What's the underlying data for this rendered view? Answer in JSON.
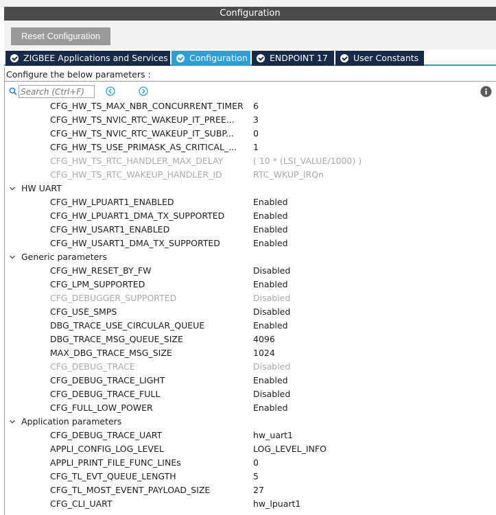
{
  "window": {
    "title": "Configuration"
  },
  "toolbar": {
    "reset_label": "Reset Configuration"
  },
  "tabs": [
    {
      "label": "ZIGBEE Applications and Services",
      "active": false
    },
    {
      "label": "Configuration",
      "active": true
    },
    {
      "label": "ENDPOINT 17",
      "active": false
    },
    {
      "label": "User Constants",
      "active": false
    }
  ],
  "panel": {
    "header": "Configure the below parameters :"
  },
  "search": {
    "placeholder": "Search (Ctrl+F)"
  },
  "icons": {
    "search": "search-icon",
    "prev": "arrow-left-circle-icon",
    "next": "arrow-right-circle-icon",
    "info": "info-icon",
    "expand": "chevron-down-icon",
    "tab_status": "check-circle-icon"
  },
  "colors": {
    "title_bar": "#4b4b4b",
    "tab_bg": "#172a4a",
    "tab_active": "#2aa0d8",
    "disabled_text": "#a9a9a9",
    "reset_button": "#9a9a9a"
  },
  "params": {
    "ts_rows": [
      {
        "name": "CFG_HW_TS_MAX_NBR_CONCURRENT_TIMER",
        "value": "6",
        "disabled": false
      },
      {
        "name": "CFG_HW_TS_NVIC_RTC_WAKEUP_IT_PREE...",
        "value": "3",
        "disabled": false
      },
      {
        "name": "CFG_HW_TS_NVIC_RTC_WAKEUP_IT_SUBP...",
        "value": "0",
        "disabled": false
      },
      {
        "name": "CFG_HW_TS_USE_PRIMASK_AS_CRITICAL_...",
        "value": "1",
        "disabled": false
      },
      {
        "name": "CFG_HW_TS_RTC_HANDLER_MAX_DELAY",
        "value": "( 10 * (LSI_VALUE/1000) )",
        "disabled": true
      },
      {
        "name": "CFG_HW_TS_RTC_WAKEUP_HANDLER_ID",
        "value": "RTC_WKUP_IRQn",
        "disabled": true
      }
    ],
    "groups": [
      {
        "name": "HW UART",
        "rows": [
          {
            "name": "CFG_HW_LPUART1_ENABLED",
            "value": "Enabled",
            "disabled": false
          },
          {
            "name": "CFG_HW_LPUART1_DMA_TX_SUPPORTED",
            "value": "Enabled",
            "disabled": false
          },
          {
            "name": "CFG_HW_USART1_ENABLED",
            "value": "Enabled",
            "disabled": false
          },
          {
            "name": "CFG_HW_USART1_DMA_TX_SUPPORTED",
            "value": "Enabled",
            "disabled": false
          }
        ]
      },
      {
        "name": "Generic parameters",
        "rows": [
          {
            "name": "CFG_HW_RESET_BY_FW",
            "value": "Disabled",
            "disabled": false
          },
          {
            "name": "CFG_LPM_SUPPORTED",
            "value": "Enabled",
            "disabled": false
          },
          {
            "name": "CFG_DEBUGGER_SUPPORTED",
            "value": "Disabled",
            "disabled": true
          },
          {
            "name": "CFG_USE_SMPS",
            "value": "Disabled",
            "disabled": false
          },
          {
            "name": "DBG_TRACE_USE_CIRCULAR_QUEUE",
            "value": "Enabled",
            "disabled": false
          },
          {
            "name": "DBG_TRACE_MSG_QUEUE_SIZE",
            "value": "4096",
            "disabled": false
          },
          {
            "name": "MAX_DBG_TRACE_MSG_SIZE",
            "value": "1024",
            "disabled": false
          },
          {
            "name": "CFG_DEBUG_TRACE",
            "value": "Disabled",
            "disabled": true
          },
          {
            "name": "CFG_DEBUG_TRACE_LIGHT",
            "value": "Enabled",
            "disabled": false
          },
          {
            "name": "CFG_DEBUG_TRACE_FULL",
            "value": "Disabled",
            "disabled": false
          },
          {
            "name": "CFG_FULL_LOW_POWER",
            "value": "Enabled",
            "disabled": false
          }
        ]
      },
      {
        "name": "Application parameters",
        "rows": [
          {
            "name": "CFG_DEBUG_TRACE_UART",
            "value": "hw_uart1",
            "disabled": false
          },
          {
            "name": "APPLI_CONFIG_LOG_LEVEL",
            "value": "LOG_LEVEL_INFO",
            "disabled": false
          },
          {
            "name": "APPLI_PRINT_FILE_FUNC_LINEs",
            "value": "0",
            "disabled": false
          },
          {
            "name": "CFG_TL_EVT_QUEUE_LENGTH",
            "value": "5",
            "disabled": false
          },
          {
            "name": "CFG_TL_MOST_EVENT_PAYLOAD_SIZE",
            "value": "27",
            "disabled": false
          },
          {
            "name": "CFG_CLI_UART",
            "value": "hw_lpuart1",
            "disabled": false
          }
        ]
      }
    ]
  }
}
